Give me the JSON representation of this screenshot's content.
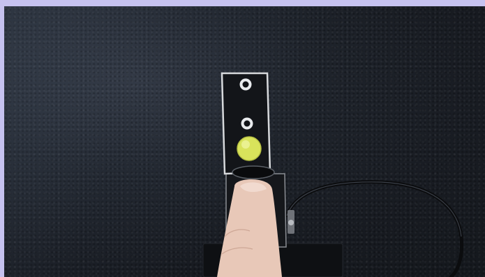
{
  "photo": {
    "subject": "finger-pressing-button-on-metal-bracket",
    "background_color": "#1c2027",
    "frame_color": "#c6c2ef",
    "led_color": "#d8e85a",
    "icons": [
      "led-light",
      "mounting-hole-icon",
      "cable",
      "finger"
    ]
  }
}
